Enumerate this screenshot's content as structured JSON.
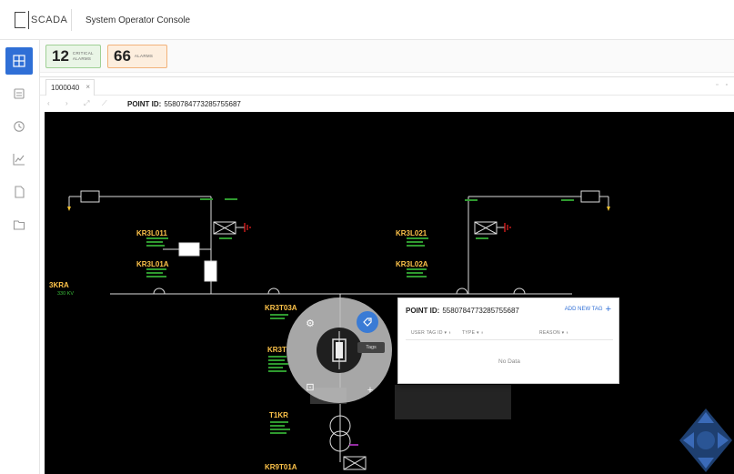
{
  "app": {
    "brand": "SCADA",
    "console_title": "System Operator Console"
  },
  "sidebar": {
    "items": [
      {
        "name": "grid-icon",
        "active": true
      },
      {
        "name": "list-icon",
        "active": false
      },
      {
        "name": "history-icon",
        "active": false
      },
      {
        "name": "chart-icon",
        "active": false
      },
      {
        "name": "document-icon",
        "active": false
      },
      {
        "name": "folder-icon",
        "active": false
      }
    ]
  },
  "alarms": {
    "critical_count": "12",
    "critical_label_1": "CRITICAL",
    "critical_label_2": "ALARMS",
    "alarms_count": "66",
    "alarms_label": "ALARMS"
  },
  "tab": {
    "label": "1000040",
    "close": "×"
  },
  "toolbar": {
    "point_id_label": "POINT ID:",
    "point_id_value": "5580784773285755687"
  },
  "diagram": {
    "labels": {
      "kr3l011": "KR3L011",
      "kr3l01a": "KR3L01A",
      "kr3l021": "KR3L021",
      "kr3l02a": "KR3L02A",
      "kr3t03a": "KR3T03A",
      "kr3t": "KR3T",
      "t1kr": "T1KR",
      "kr9t01a": "KR9T01A",
      "kr9": "3KRA",
      "bus_kv": "330 KV"
    }
  },
  "radial_menu": {
    "tags_label": "Tags"
  },
  "popup": {
    "title_label": "POINT ID:",
    "title_value": "5580784773285755687",
    "add_tag": "ADD NEW TAG",
    "add_icon": "+",
    "col_user": "USER TAG ID",
    "col_type": "TYPE",
    "col_reason": "REASON",
    "no_data": "No Data"
  },
  "colors": {
    "accent": "#2f6fd6",
    "label_yellow": "#ffc44a",
    "value_green": "#3bbf3b",
    "ground_red": "#e02020",
    "critical_bg": "#e9f5e6",
    "alarm_bg": "#fdeede"
  }
}
